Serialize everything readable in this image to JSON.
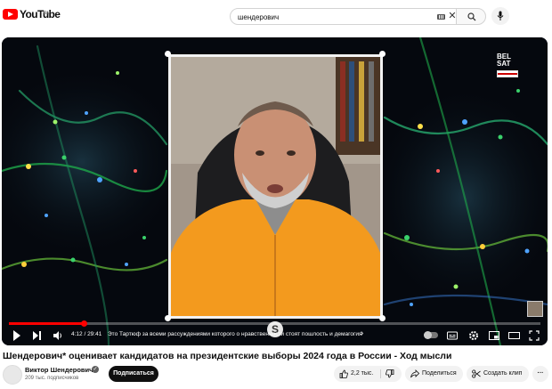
{
  "header": {
    "logo_text": "YouTube",
    "logo_region": "RU",
    "search_value": "шендерович"
  },
  "player": {
    "watermark_line1": "BEL",
    "watermark_line2": "SAT",
    "time": "4:12 / 29:41",
    "chapter": "Это Тартюф за всеми рассуждениями которого о нравственности стоят пошлость и демагогия",
    "chapter_chevron": "›",
    "progress_fraction": 0.141,
    "accent_color": "#ff0000"
  },
  "video": {
    "title": "Шендерович* оценивает кандидатов на президентские выборы 2024 года в России - Ход мысли"
  },
  "channel": {
    "name": "Виктор Шендерович",
    "subscribers": "209 тыс. подписчиков",
    "subscribe_label": "Подписаться"
  },
  "actions": {
    "like_count": "2,2 тыс.",
    "share_label": "Поделиться",
    "clip_label": "Создать клип",
    "more_label": "···"
  }
}
